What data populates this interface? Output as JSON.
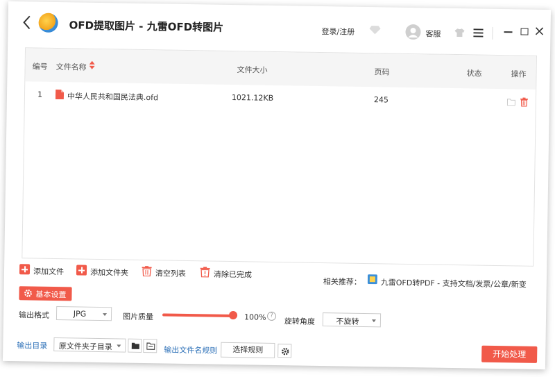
{
  "app": {
    "title": "OFD提取图片 - 九雷OFD转图片",
    "login": "登录/注册",
    "service": "客服"
  },
  "table": {
    "columns": {
      "index": "编号",
      "name": "文件名称",
      "size": "文件大小",
      "pages": "页码",
      "status": "状态",
      "ops": "操作"
    },
    "rows": [
      {
        "index": "1",
        "name": "中华人民共和国民法典.ofd",
        "size": "1021.12KB",
        "pages": "245",
        "status": ""
      }
    ]
  },
  "actions": {
    "add_file": "添加文件",
    "add_folder": "添加文件夹",
    "clear_list": "清空列表",
    "clear_done": "清除已完成"
  },
  "recommend": {
    "label": "相关推荐：",
    "link": "九雷OFD转PDF - 支持文档/发票/公章/新变"
  },
  "settings": {
    "tab_label": "基本设置",
    "format_label": "输出格式",
    "format_value": "JPG",
    "quality_label": "图片质量",
    "quality_value": "100%",
    "quality_level": 100,
    "rotate_label": "旋转角度",
    "rotate_value": "不旋转",
    "output_dir_label": "输出目录",
    "output_dir_value": "原文件夹子目录",
    "name_rule_label": "输出文件名规则",
    "choose_rule": "选择规则",
    "start": "开始处理"
  },
  "colors": {
    "accent": "#f15a4a",
    "header_bg": "#f5f5f5"
  },
  "icons": [
    "back-arrow-icon",
    "app-logo-icon",
    "vip-diamond-icon",
    "avatar-icon",
    "skin-shirt-icon",
    "menu-icon",
    "minimize-icon",
    "maximize-icon",
    "close-icon",
    "sort-icon",
    "ofd-file-icon",
    "folder-icon",
    "trash-icon",
    "plus-icon",
    "gear-icon",
    "help-icon"
  ]
}
